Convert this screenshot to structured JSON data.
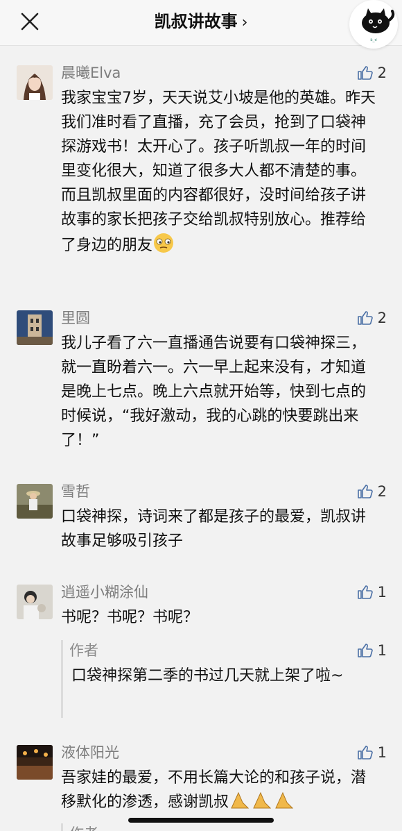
{
  "header": {
    "title": "凯叔讲故事",
    "chevron": "›",
    "close_icon": "close-icon",
    "logo_text": "ಠಿ_ಠ"
  },
  "comments": [
    {
      "user": "晨曦Elva",
      "likes": "2",
      "text": "我家宝宝7岁，天天说艾小坡是他的英雄。昨天我们准时看了直播，充了会员，抢到了口袋神探游戏书！太开心了。孩子听凯叔一年的时间里变化很大，知道了很多大人都不清楚的事。而且凯叔里面的内容都很好，没时间给孩子讲故事的家长把孩子交给凯叔特别放心。推荐给了身边的朋友"
    },
    {
      "user": "里圆",
      "likes": "2",
      "text": "我儿子看了六一直播通告说要有口袋神探三，就一直盼着六一。六一早上起来没有，才知道是晚上七点。晚上六点就开始等，快到七点的时候说，“我好激动，我的心跳的快要跳出来了！”"
    },
    {
      "user": "雪哲",
      "likes": "2",
      "text": "口袋神探，诗词来了都是孩子的最爱，凯叔讲故事足够吸引孩子"
    },
    {
      "user": "逍遥小糊涂仙",
      "likes": "1",
      "text": "书呢？书呢？书呢？",
      "reply": {
        "user": "作者",
        "likes": "1",
        "text": "口袋神探第二季的书过几天就上架了啦~"
      }
    },
    {
      "user": "液体阳光",
      "likes": "1",
      "text": "吾家娃的最爱，不用长篇大论的和孩子说，潜移默化的渗透，感谢凯叔"
    }
  ],
  "partial_reply_user": "作者",
  "colors": {
    "background": "#f2f2f2",
    "username": "#7d7d7d",
    "text": "#111111"
  }
}
